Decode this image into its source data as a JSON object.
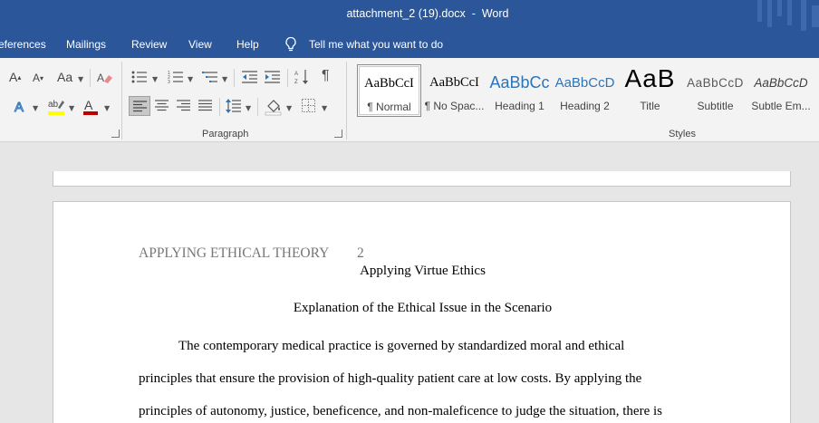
{
  "window": {
    "title": "attachment_2 (19).docx  -  Word"
  },
  "tabs": [
    {
      "label": "eferences"
    },
    {
      "label": "Mailings"
    },
    {
      "label": "Review"
    },
    {
      "label": "View"
    },
    {
      "label": "Help"
    }
  ],
  "tell_me": {
    "placeholder": "Tell me what you want to do"
  },
  "ribbon": {
    "font_glyph_grow": "A",
    "font_glyph_shrink": "A",
    "change_case": "Aa",
    "paragraph_group_label": "Paragraph",
    "styles_group_label": "Styles",
    "colors": {
      "highlight": "#ffff00",
      "font_color": "#c00000",
      "text_effects": "#2e75b6"
    }
  },
  "styles": [
    {
      "sample": "AaBbCcI",
      "name": "¶ Normal",
      "selected": true
    },
    {
      "sample": "AaBbCcI",
      "name": "¶ No Spac..."
    },
    {
      "sample": "AaBbCc",
      "name": "Heading 1"
    },
    {
      "sample": "AaBbCcD",
      "name": "Heading 2"
    },
    {
      "sample": "AaB",
      "name": "Title"
    },
    {
      "sample": "AaBbCcD",
      "name": "Subtitle"
    },
    {
      "sample": "AaBbCcD",
      "name": "Subtle Em..."
    }
  ],
  "document": {
    "running_head": "APPLYING ETHICAL THEORY",
    "page_number": "2",
    "title": "Applying Virtue Ethics",
    "section_heading": "Explanation of the Ethical Issue in the Scenario",
    "lines": [
      "The contemporary medical practice is governed by standardized moral and ethical",
      "principles that ensure the provision of high-quality patient care at low costs. By applying the",
      "principles of autonomy, justice, beneficence, and non-maleficence to judge the situation, there is"
    ]
  }
}
